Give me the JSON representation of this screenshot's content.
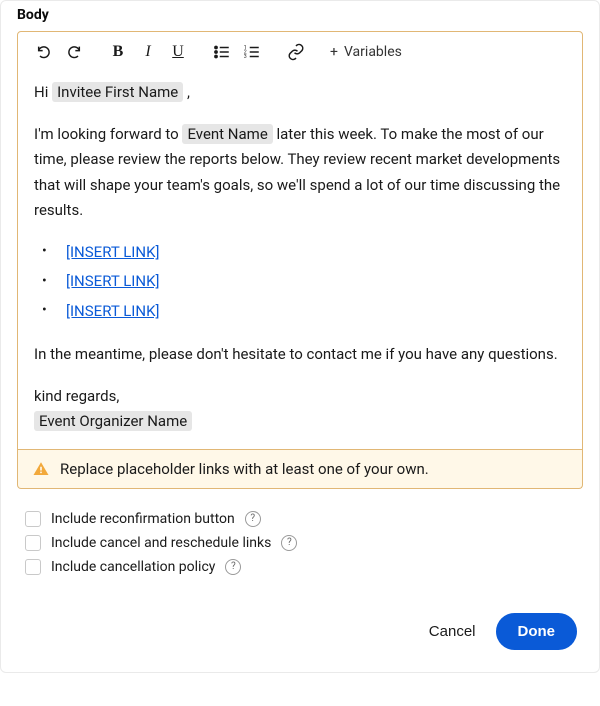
{
  "section": {
    "title": "Body"
  },
  "toolbar": {
    "bold": "B",
    "italic": "I",
    "underline": "U",
    "variables": "Variables"
  },
  "body": {
    "greeting_prefix": "Hi ",
    "greeting_var": "Invitee First Name",
    "greeting_suffix": " ,",
    "para1_a": "I'm looking forward to ",
    "para1_var": "Event Name",
    "para1_b": " later this week. To make the most of our time, please review the reports below. They review recent market developments that will shape your team's goals, so we'll spend a lot of our time discussing the results.",
    "links": [
      "[INSERT LINK]",
      "[INSERT LINK]",
      "[INSERT LINK]"
    ],
    "para2": "In the meantime, please don't hesitate to contact me if you have any questions.",
    "signoff_line": "kind regards,",
    "signoff_var": "Event Organizer Name"
  },
  "warning": {
    "text": "Replace placeholder links with at least one of your own."
  },
  "options": {
    "reconfirm": "Include reconfirmation button",
    "cancel_reschedule": "Include cancel and reschedule links",
    "cancellation_policy": "Include cancellation policy",
    "help_glyph": "?"
  },
  "actions": {
    "cancel": "Cancel",
    "done": "Done"
  }
}
